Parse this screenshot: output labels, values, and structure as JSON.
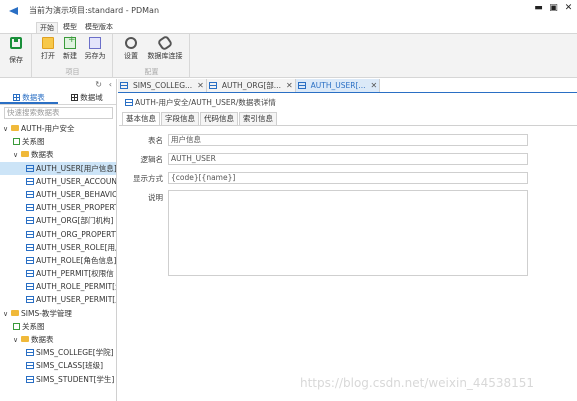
{
  "window": {
    "title": "当前为演示项目:standard - PDMan",
    "controls": [
      "▬",
      "▣",
      "✕"
    ]
  },
  "ribbon": {
    "tabs": [
      "开始",
      "模型",
      "模型版本"
    ],
    "save_label": "保存",
    "open_label": "打开",
    "new_label": "新建",
    "saveas_label": "另存为",
    "settings_label": "设置",
    "dbconn_label": "数据库连接",
    "group_project": "项目",
    "group_config": "配置"
  },
  "left": {
    "tab_tables": "数据表",
    "tab_domains": "数据域",
    "search_placeholder": "快速搜索数据表",
    "tree": [
      {
        "level": 0,
        "type": "folder",
        "label": "AUTH-用户安全"
      },
      {
        "level": 1,
        "type": "rel",
        "label": "关系图"
      },
      {
        "level": 1,
        "type": "folder",
        "label": "数据表"
      },
      {
        "level": 2,
        "type": "table",
        "label": "AUTH_USER[用户信息]",
        "selected": true
      },
      {
        "level": 2,
        "type": "table",
        "label": "AUTH_USER_ACCOUNT"
      },
      {
        "level": 2,
        "type": "table",
        "label": "AUTH_USER_BEHAVIOR"
      },
      {
        "level": 2,
        "type": "table",
        "label": "AUTH_USER_PROPERTY"
      },
      {
        "level": 2,
        "type": "table",
        "label": "AUTH_ORG[部门机构]"
      },
      {
        "level": 2,
        "type": "table",
        "label": "AUTH_ORG_PROPERTY"
      },
      {
        "level": 2,
        "type": "table",
        "label": "AUTH_USER_ROLE[用户"
      },
      {
        "level": 2,
        "type": "table",
        "label": "AUTH_ROLE[角色信息]"
      },
      {
        "level": 2,
        "type": "table",
        "label": "AUTH_PERMIT[权限信"
      },
      {
        "level": 2,
        "type": "table",
        "label": "AUTH_ROLE_PERMIT[角"
      },
      {
        "level": 2,
        "type": "table",
        "label": "AUTH_USER_PERMIT[用"
      },
      {
        "level": 0,
        "type": "folder",
        "label": "SIMS-教学管理"
      },
      {
        "level": 1,
        "type": "rel",
        "label": "关系图"
      },
      {
        "level": 1,
        "type": "folder",
        "label": "数据表"
      },
      {
        "level": 2,
        "type": "table",
        "label": "SIMS_COLLEGE[学院]"
      },
      {
        "level": 2,
        "type": "table",
        "label": "SIMS_CLASS[班级]"
      },
      {
        "level": 2,
        "type": "table",
        "label": "SIMS_STUDENT[学生]"
      }
    ]
  },
  "doc_tabs": [
    {
      "label": "SIMS_COLLEG...",
      "active": false
    },
    {
      "label": "AUTH_ORG[部...",
      "active": false
    },
    {
      "label": "AUTH_USER[...",
      "active": true
    }
  ],
  "breadcrumb": "AUTH-用户安全/AUTH_USER/数据表详情",
  "sub_tabs": [
    "基本信息",
    "字段信息",
    "代码信息",
    "索引信息"
  ],
  "form": {
    "table_name_label": "表名",
    "table_name_value": "用户信息",
    "logic_name_label": "逻辑名",
    "logic_name_value": "AUTH_USER",
    "display_label": "显示方式",
    "display_value": "{code}[{name}]",
    "desc_label": "说明",
    "desc_value": ""
  },
  "watermark": "https://blog.csdn.net/weixin_44538151",
  "colors": {
    "accent": "#2a6fc4",
    "folder": "#f0b93a",
    "relation": "#3a9b3a"
  }
}
